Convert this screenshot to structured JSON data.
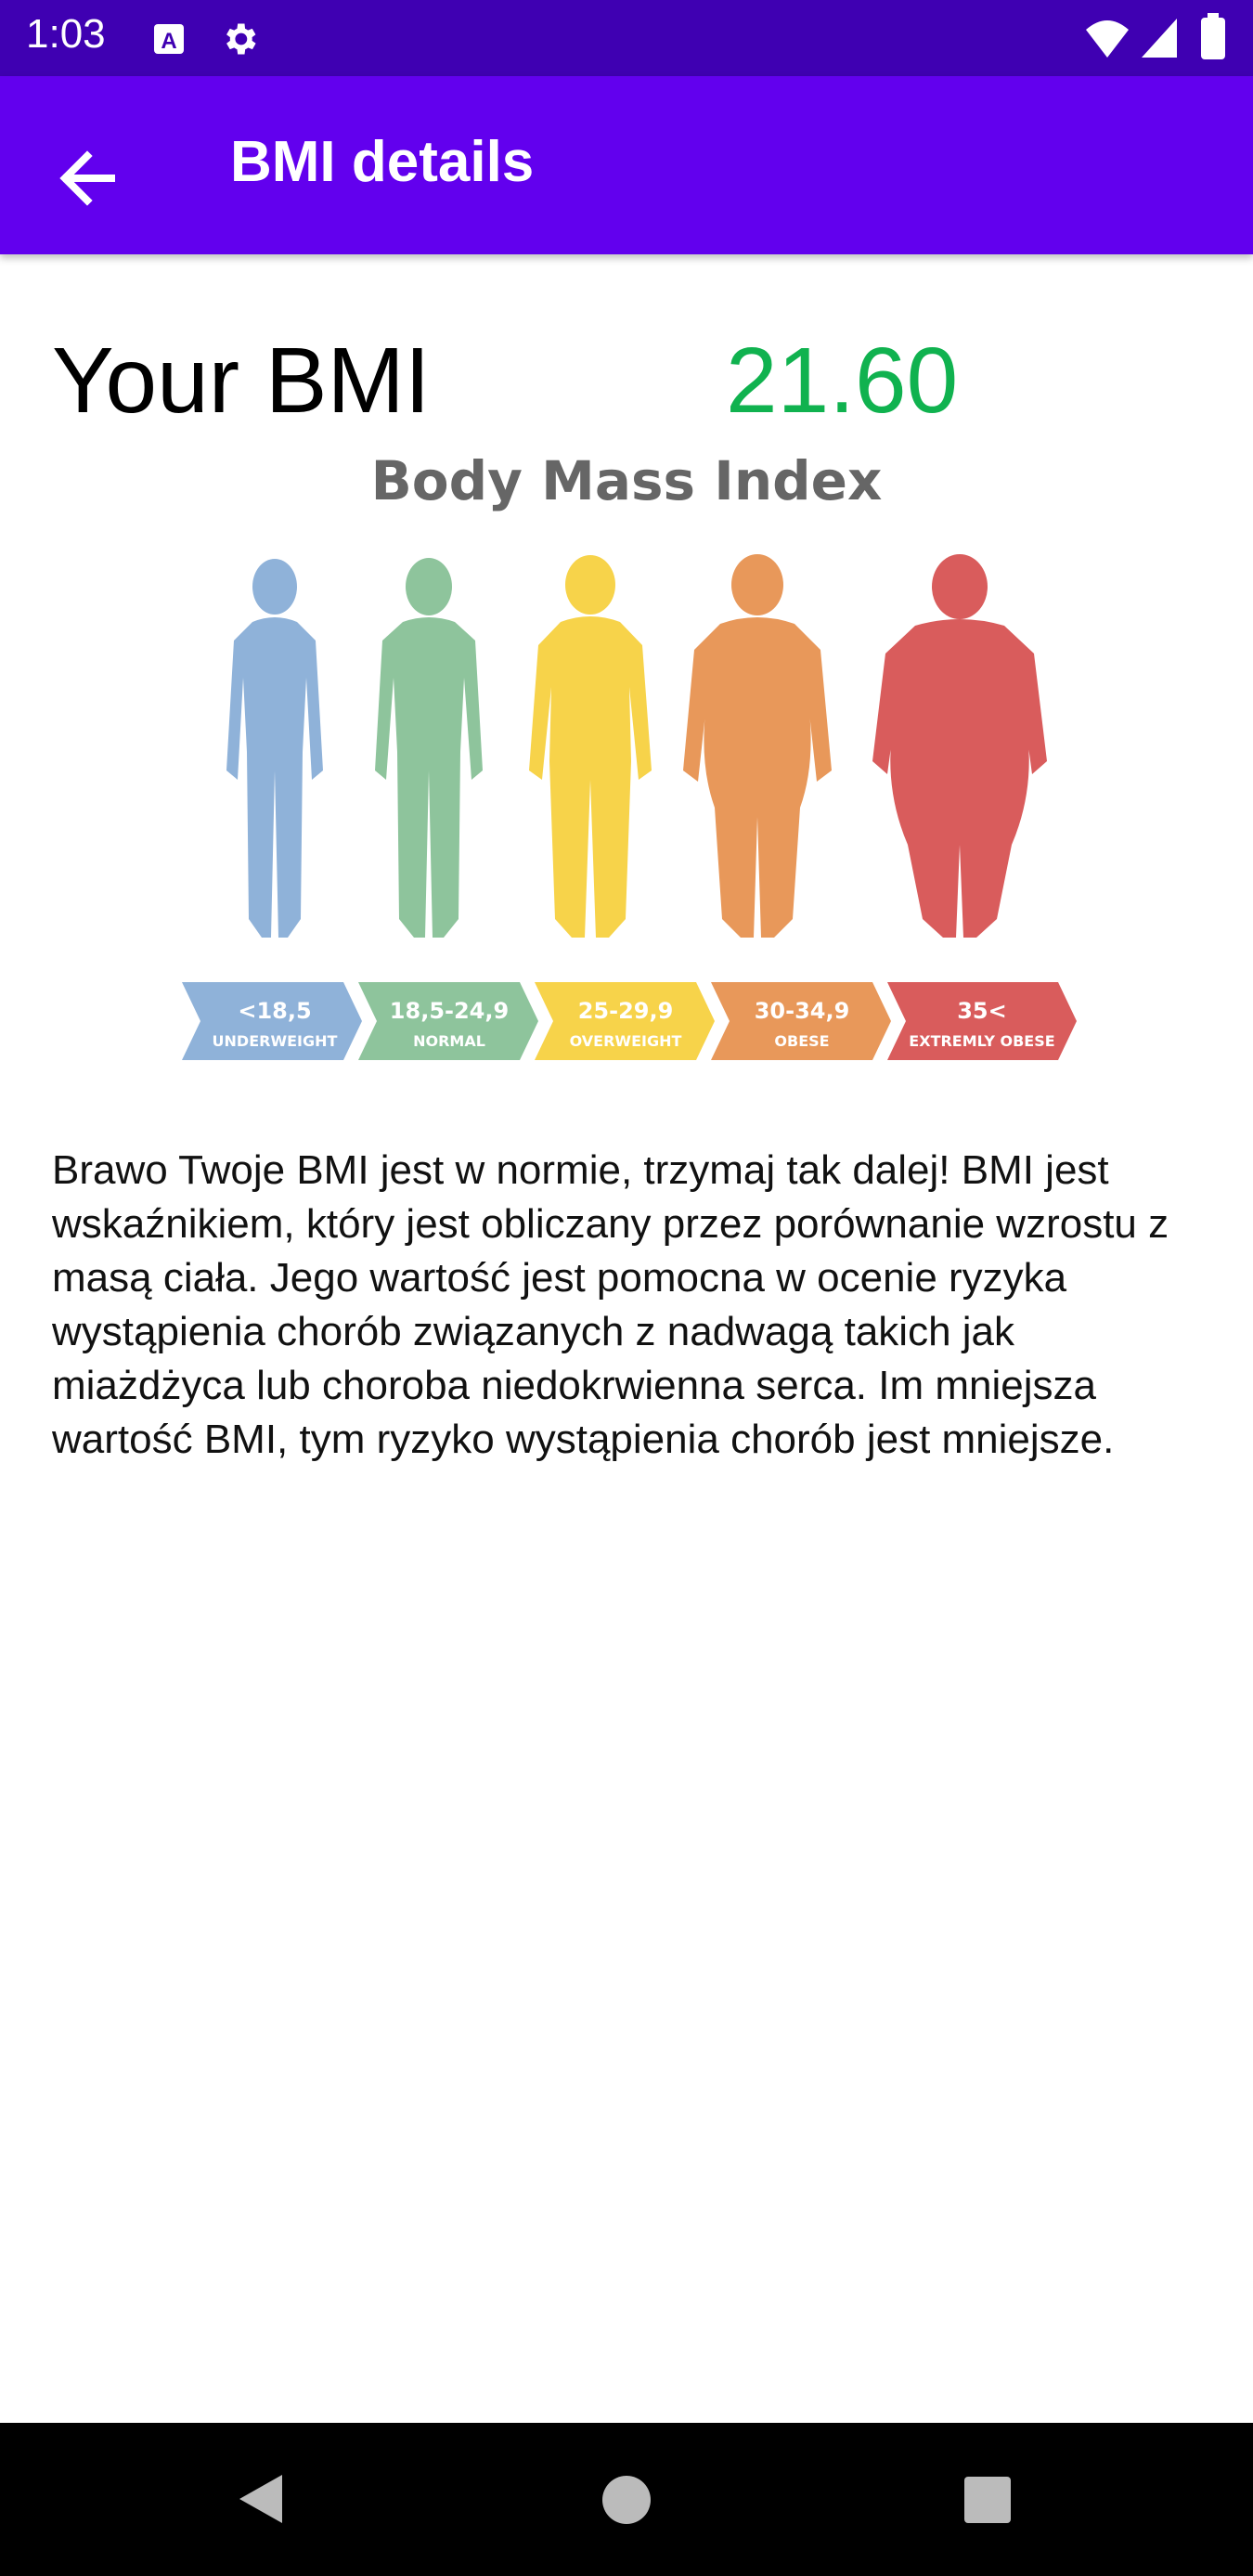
{
  "status_bar": {
    "time": "1:03",
    "icons": [
      "a-letter-icon",
      "gear-icon",
      "wifi-icon",
      "signal-icon",
      "battery-icon"
    ]
  },
  "app_bar": {
    "title": "BMI details",
    "back_icon": "arrow-left-icon",
    "background": "#6200ee"
  },
  "bmi": {
    "label": "Your BMI",
    "value": "21.60",
    "value_color": "#10b24f"
  },
  "infographic": {
    "title": "Body Mass Index",
    "categories": [
      {
        "range": "<18,5",
        "label": "UNDERWEIGHT",
        "color": "#8fb2d9"
      },
      {
        "range": "18,5-24,9",
        "label": "NORMAL",
        "color": "#8ec49c"
      },
      {
        "range": "25-29,9",
        "label": "OVERWEIGHT",
        "color": "#f7d34a"
      },
      {
        "range": "30-34,9",
        "label": "OBESE",
        "color": "#e8985a"
      },
      {
        "range": "35<",
        "label": "EXTREMLY OBESE",
        "color": "#d95c5c"
      }
    ]
  },
  "description": "Brawo Twoje BMI jest w normie, trzymaj tak dalej! BMI jest wskaźnikiem, który jest obliczany przez porównanie wzrostu z masą ciała. Jego wartość jest pomocna w ocenie ryzyka wystąpienia chorób związanych z nadwagą takich jak miażdżyca lub choroba niedokrwienna serca. Im mniejsza wartość BMI, tym ryzyko wystąpienia chorób jest mniejsze.",
  "nav_bar": {
    "buttons": [
      "back-triangle-icon",
      "home-circle-icon",
      "recents-square-icon"
    ]
  }
}
